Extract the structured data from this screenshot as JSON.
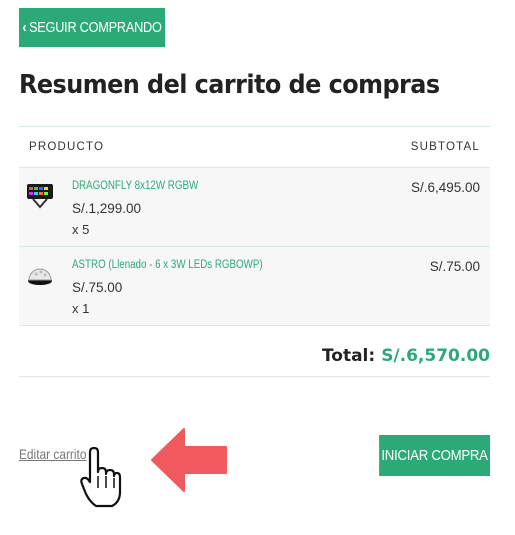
{
  "nav": {
    "continue_label": "SEGUIR COMPRANDO",
    "continue_icon": "chevron-left-icon"
  },
  "cart": {
    "title": "Resumen del carrito de compras",
    "columns": {
      "product": "PRODUCTO",
      "subtotal": "SUBTOTAL"
    },
    "items": [
      {
        "name": "DRAGONFLY 8x12W RGBW",
        "price": "S/.1,299.00",
        "qty": "x 5",
        "subtotal": "S/.6,495.00",
        "thumb_icon": "led-bar-light-icon"
      },
      {
        "name": "ASTRO (Llenado - 6 x 3W LEDs RGBOWP)",
        "price": "S/.75.00",
        "qty": "x 1",
        "subtotal": "S/.75.00",
        "thumb_icon": "dome-light-icon"
      }
    ],
    "total_label": "Total:",
    "total_value": "S/.6,570.00"
  },
  "actions": {
    "edit_label": "Editar carrito",
    "checkout_label": "INICIAR COMPRA"
  },
  "colors": {
    "accent": "#2baa78",
    "arrow": "#f05a5f"
  }
}
